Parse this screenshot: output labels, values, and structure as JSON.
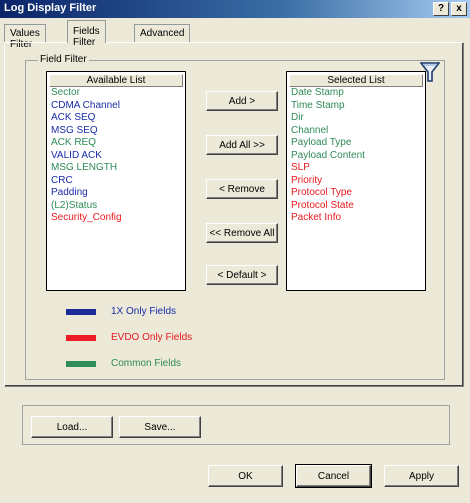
{
  "window": {
    "title": "Log Display Filter",
    "help_label": "?",
    "close_label": "x"
  },
  "tabs": [
    {
      "label": "Values Filter",
      "active": false
    },
    {
      "label": "Fields Filter",
      "active": true
    },
    {
      "label": "Advanced",
      "active": false
    }
  ],
  "group": {
    "label": "Field Filter"
  },
  "available": {
    "header": "Available List",
    "items": [
      {
        "label": "Sector",
        "type": "common"
      },
      {
        "label": "CDMA Channel",
        "type": "1x"
      },
      {
        "label": "ACK SEQ",
        "type": "1x"
      },
      {
        "label": "MSG SEQ",
        "type": "1x"
      },
      {
        "label": "ACK REQ",
        "type": "common"
      },
      {
        "label": "VALID ACK",
        "type": "1x"
      },
      {
        "label": "MSG LENGTH",
        "type": "common"
      },
      {
        "label": "CRC",
        "type": "1x"
      },
      {
        "label": "Padding",
        "type": "1x"
      },
      {
        "label": "(L2)Status",
        "type": "common"
      },
      {
        "label": "Security_Config",
        "type": "evdo"
      }
    ]
  },
  "selected": {
    "header": "Selected List",
    "items": [
      {
        "label": "Date Stamp",
        "type": "common"
      },
      {
        "label": "Time Stamp",
        "type": "common"
      },
      {
        "label": "Dir",
        "type": "common"
      },
      {
        "label": "Channel",
        "type": "common"
      },
      {
        "label": "Payload Type",
        "type": "common"
      },
      {
        "label": "Payload Content",
        "type": "common"
      },
      {
        "label": "SLP",
        "type": "evdo"
      },
      {
        "label": "Priority",
        "type": "evdo"
      },
      {
        "label": "Protocol Type",
        "type": "evdo"
      },
      {
        "label": "Protocol State",
        "type": "evdo"
      },
      {
        "label": "Packet Info",
        "type": "evdo"
      }
    ]
  },
  "buttons": {
    "add": "Add >",
    "add_all": "Add All >>",
    "remove": "< Remove",
    "remove_all": "<< Remove All",
    "default": "< Default >",
    "load": "Load...",
    "save": "Save...",
    "ok": "OK",
    "cancel": "Cancel",
    "apply": "Apply"
  },
  "legend": [
    {
      "label": "1X Only Fields",
      "type": "1x"
    },
    {
      "label": "EVDO Only Fields",
      "type": "evdo"
    },
    {
      "label": "Common Fields",
      "type": "common"
    }
  ],
  "colors": {
    "1x": "#1a2ca8",
    "evdo": "#e8191e",
    "common": "#2e8b57",
    "swatch_1x": "#1c2a9a",
    "swatch_evdo": "#ee1c25",
    "swatch_common": "#2f8e5a"
  },
  "icons": {
    "filter": "funnel-icon"
  }
}
